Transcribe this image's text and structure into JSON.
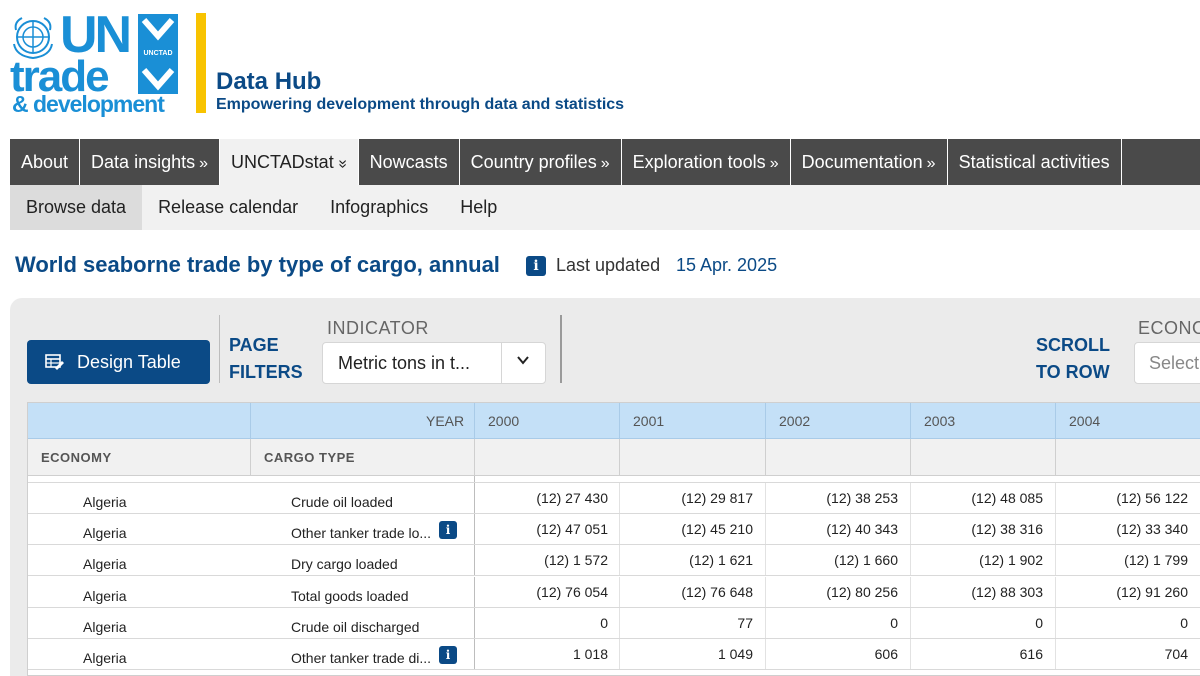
{
  "brand": {
    "logo_un": "UN",
    "logo_trade": "trade",
    "logo_development": "& development",
    "logo_badge": "UNCTAD",
    "hub_title": "Data Hub",
    "hub_subtitle": "Empowering development through data and statistics",
    "brand_blue": "#1a8fd6",
    "navy": "#0b4a86",
    "accent_yellow": "#f8c300"
  },
  "main_nav": [
    {
      "label": "About",
      "chevron": ""
    },
    {
      "label": "Data insights",
      "chevron": "»"
    },
    {
      "label": "UNCTADstat",
      "chevron": "»"
    },
    {
      "label": "Nowcasts",
      "chevron": ""
    },
    {
      "label": "Country profiles",
      "chevron": "»"
    },
    {
      "label": "Exploration tools",
      "chevron": "»"
    },
    {
      "label": "Documentation",
      "chevron": "»"
    },
    {
      "label": "Statistical activities",
      "chevron": ""
    }
  ],
  "sub_nav": [
    {
      "label": "Browse data"
    },
    {
      "label": "Release calendar"
    },
    {
      "label": "Infographics"
    },
    {
      "label": "Help"
    }
  ],
  "page": {
    "title": "World seaborne trade by type of cargo, annual",
    "last_updated_label": "Last updated",
    "last_updated_date": "15 Apr. 2025",
    "info_glyph": "i"
  },
  "toolbar": {
    "design_table_label": "Design Table",
    "page_filters_line1": "PAGE",
    "page_filters_line2": "FILTERS",
    "indicator_label": "INDICATOR",
    "indicator_value": "Metric tons in t...",
    "scroll_line1": "SCROLL",
    "scroll_line2": "TO ROW",
    "economy_label": "ECONO",
    "economy_placeholder": "Select"
  },
  "table": {
    "year_label": "YEAR",
    "years": [
      "2000",
      "2001",
      "2002",
      "2003",
      "2004"
    ],
    "col_economy": "ECONOMY",
    "col_cargo": "CARGO TYPE",
    "rows": [
      {
        "economy": "Algeria",
        "cargo": "Crude oil loaded",
        "info": false,
        "values": [
          "(12) 27 430",
          "(12) 29 817",
          "(12) 38 253",
          "(12) 48 085",
          "(12) 56 122"
        ]
      },
      {
        "economy": "Algeria",
        "cargo": "Other tanker trade lo...",
        "info": true,
        "values": [
          "(12) 47 051",
          "(12) 45 210",
          "(12) 40 343",
          "(12) 38 316",
          "(12) 33 340"
        ]
      },
      {
        "economy": "Algeria",
        "cargo": "Dry cargo loaded",
        "info": false,
        "values": [
          "(12) 1 572",
          "(12) 1 621",
          "(12) 1 660",
          "(12) 1 902",
          "(12) 1 799"
        ]
      },
      {
        "economy": "Algeria",
        "cargo": "Total goods loaded",
        "info": false,
        "values": [
          "(12) 76 054",
          "(12) 76 648",
          "(12) 80 256",
          "(12) 88 303",
          "(12) 91 260"
        ]
      },
      {
        "economy": "Algeria",
        "cargo": "Crude oil discharged",
        "info": false,
        "values": [
          "0",
          "77",
          "0",
          "0",
          "0"
        ]
      },
      {
        "economy": "Algeria",
        "cargo": "Other tanker trade di...",
        "info": true,
        "values": [
          "1 018",
          "1 049",
          "606",
          "616",
          "704"
        ]
      }
    ]
  }
}
